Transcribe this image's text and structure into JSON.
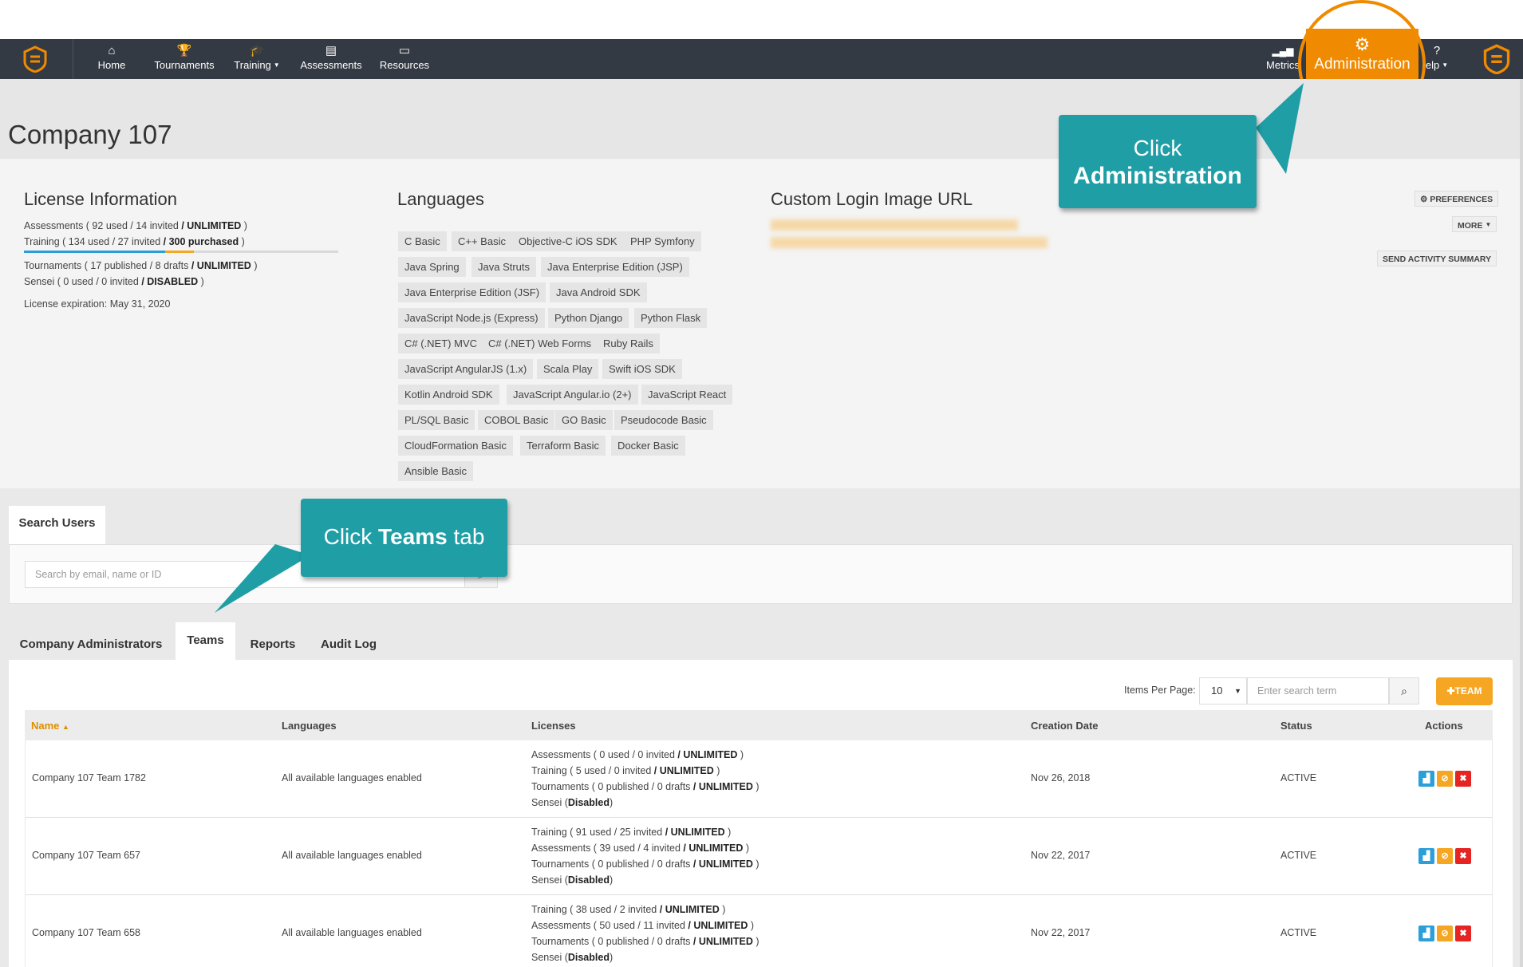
{
  "nav": {
    "items": [
      {
        "label": "Home",
        "icon": "home-icon"
      },
      {
        "label": "Tournaments",
        "icon": "trophy-icon"
      },
      {
        "label": "Training",
        "icon": "graduation-cap-icon"
      },
      {
        "label": "Assessments",
        "icon": "document-icon"
      },
      {
        "label": "Resources",
        "icon": "monitor-icon"
      }
    ],
    "metrics_label": "Metrics",
    "admin_label": "Administration",
    "help_label": "elp",
    "brand_color": "#f08a00",
    "navbar_color": "#343a43"
  },
  "page": {
    "title": "Company 107"
  },
  "license": {
    "heading": "License Information",
    "assessments": {
      "prefix": "Assessments ( 92 used / 14 invited ",
      "strong": "/ UNLIMITED",
      "suffix": " )"
    },
    "training": {
      "prefix": "Training ( 134 used / 27 invited ",
      "strong": "/ 300 purchased",
      "suffix": " )"
    },
    "training_usage_fraction": 0.45,
    "training_invited_fraction": 0.09,
    "tournaments": {
      "prefix": "Tournaments ( 17 published / 8 drafts ",
      "strong": "/ UNLIMITED",
      "suffix": " )"
    },
    "sensei": {
      "prefix": "Sensei ( 0 used / 0 invited ",
      "strong": "/ DISABLED",
      "suffix": " )"
    },
    "expiration": "License expiration: May 31, 2020"
  },
  "languages": {
    "heading": "Languages",
    "tags": [
      "C Basic",
      "C++ Basic",
      "Objective-C iOS SDK",
      "PHP Symfony",
      "Java Spring",
      "Java Struts",
      "Java Enterprise Edition (JSP)",
      "Java Enterprise Edition (JSF)",
      "Java Android SDK",
      "JavaScript Node.js (Express)",
      "Python Django",
      "Python Flask",
      "C# (.NET) MVC",
      "C# (.NET) Web Forms",
      "Ruby Rails",
      "JavaScript AngularJS (1.x)",
      "Scala Play",
      "Swift iOS SDK",
      "Kotlin Android SDK",
      "JavaScript Angular.io (2+)",
      "JavaScript React",
      "PL/SQL Basic",
      "COBOL Basic",
      "GO Basic",
      "Pseudocode Basic",
      "CloudFormation Basic",
      "Terraform Basic",
      "Docker Basic",
      "Ansible Basic"
    ]
  },
  "custom_login": {
    "heading": "Custom Login Image URL"
  },
  "side_buttons": {
    "preferences": "PREFERENCES",
    "more": "MORE",
    "send_summary": "SEND ACTIVITY SUMMARY"
  },
  "callouts": {
    "admin": {
      "line1": "Click",
      "line2": "Administration"
    },
    "teams": {
      "prefix": "Click ",
      "strong": "Teams",
      "suffix": " tab"
    }
  },
  "search_users": {
    "tab_label": "Search Users",
    "placeholder": "Search by email, name or ID"
  },
  "tabs": [
    {
      "label": "Company Administrators",
      "active": false
    },
    {
      "label": "Teams",
      "active": true
    },
    {
      "label": "Reports",
      "active": false
    },
    {
      "label": "Audit Log",
      "active": false
    }
  ],
  "teams_toolbar": {
    "items_per_page_label": "Items Per Page:",
    "items_per_page_value": "10",
    "search_placeholder": "Enter search term",
    "add_team_label": "TEAM"
  },
  "table": {
    "headers": {
      "name": "Name",
      "languages": "Languages",
      "licenses": "Licenses",
      "created": "Creation Date",
      "status": "Status",
      "actions": "Actions"
    },
    "rows": [
      {
        "name": "Company 107 Team 1782",
        "languages": "All available languages enabled",
        "licenses": [
          {
            "prefix": "Assessments ( 0 used / 0 invited ",
            "strong": "/ UNLIMITED",
            "suffix": " )"
          },
          {
            "prefix": "Training ( 5 used / 0 invited ",
            "strong": "/ UNLIMITED",
            "suffix": " )"
          },
          {
            "prefix": "Tournaments ( 0 published / 0 drafts ",
            "strong": "/ UNLIMITED",
            "suffix": " )"
          },
          {
            "prefix": "Sensei (",
            "strong": "Disabled",
            "suffix": ")"
          }
        ],
        "created": "Nov 26, 2018",
        "status": "ACTIVE"
      },
      {
        "name": "Company 107 Team 657",
        "languages": "All available languages enabled",
        "licenses": [
          {
            "prefix": "Training ( 91 used / 25 invited ",
            "strong": "/ UNLIMITED",
            "suffix": " )"
          },
          {
            "prefix": "Assessments ( 39 used / 4 invited ",
            "strong": "/ UNLIMITED",
            "suffix": " )"
          },
          {
            "prefix": "Tournaments ( 0 published / 0 drafts ",
            "strong": "/ UNLIMITED",
            "suffix": " )"
          },
          {
            "prefix": "Sensei (",
            "strong": "Disabled",
            "suffix": ")"
          }
        ],
        "created": "Nov 22, 2017",
        "status": "ACTIVE"
      },
      {
        "name": "Company 107 Team 658",
        "languages": "All available languages enabled",
        "licenses": [
          {
            "prefix": "Training ( 38 used / 2 invited ",
            "strong": "/ UNLIMITED",
            "suffix": " )"
          },
          {
            "prefix": "Assessments ( 50 used / 11 invited ",
            "strong": "/ UNLIMITED",
            "suffix": " )"
          },
          {
            "prefix": "Tournaments ( 0 published / 0 drafts ",
            "strong": "/ UNLIMITED",
            "suffix": " )"
          },
          {
            "prefix": "Sensei (",
            "strong": "Disabled",
            "suffix": ")"
          }
        ],
        "created": "Nov 22, 2017",
        "status": "ACTIVE"
      }
    ]
  }
}
